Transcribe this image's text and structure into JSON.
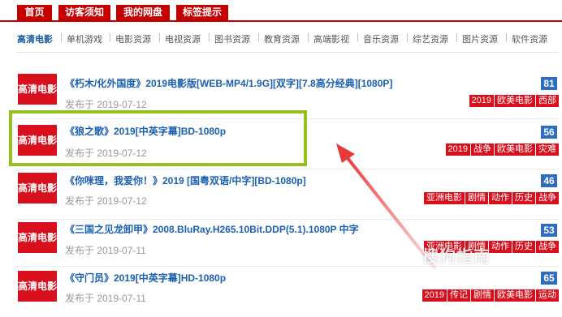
{
  "top_tabs": [
    "首页",
    "访客须知",
    "我的网盘",
    "标签提示"
  ],
  "categories": [
    "高清电影",
    "单机游戏",
    "电影资源",
    "电视资源",
    "图书资源",
    "教育资源",
    "高端影视",
    "音乐资源",
    "综艺资源",
    "图片资源",
    "软件资源"
  ],
  "active_category": "高清电影",
  "rows": [
    {
      "thumb": "高清电影",
      "title": "《朽木/化外国度》2019电影版[WEB-MP4/1.9G][双字][7.8高分经典][1080P]",
      "date": "发布于 2019-07-12",
      "count": "81",
      "tags": [
        "2019",
        "欧美电影",
        "西部"
      ]
    },
    {
      "thumb": "高清电影",
      "title": "《狼之歌》2019[中英字幕]BD-1080p",
      "date": "发布于 2019-07-12",
      "count": "56",
      "tags": [
        "2019",
        "战争",
        "欧美电影",
        "灾难"
      ]
    },
    {
      "thumb": "高清电影",
      "title": "《你咪理，我爱你！》2019 [国粤双语/中字][BD-1080p]",
      "date": "发布于 2019-07-12",
      "count": "46",
      "tags": [
        "亚洲电影",
        "剧情",
        "动作",
        "历史",
        "战争"
      ]
    },
    {
      "thumb": "高清电影",
      "title": "《三国之见龙卸甲》2008.BluRay.H265.10Bit.DDP(5.1).1080P 中字",
      "date": "发布于 2019-07-11",
      "count": "53",
      "tags": [
        "亚洲电影",
        "剧情",
        "动作",
        "历史",
        "战争"
      ]
    },
    {
      "thumb": "高清电影",
      "title": "《守门员》2019[中英字幕]HD-1080p",
      "date": "发布于 2019-07-11",
      "count": "65",
      "tags": [
        "2019",
        "传记",
        "剧情",
        "欧美电影",
        "运动"
      ]
    }
  ],
  "watermark": "搜狗指南",
  "colors": {
    "accent_red": "#d8101d",
    "nav_red": "#c40000",
    "count_blue": "#2d6cc0",
    "title_blue": "#1b5fb0",
    "highlight_green": "#94c11f",
    "arrow_red": "#e8383a"
  }
}
